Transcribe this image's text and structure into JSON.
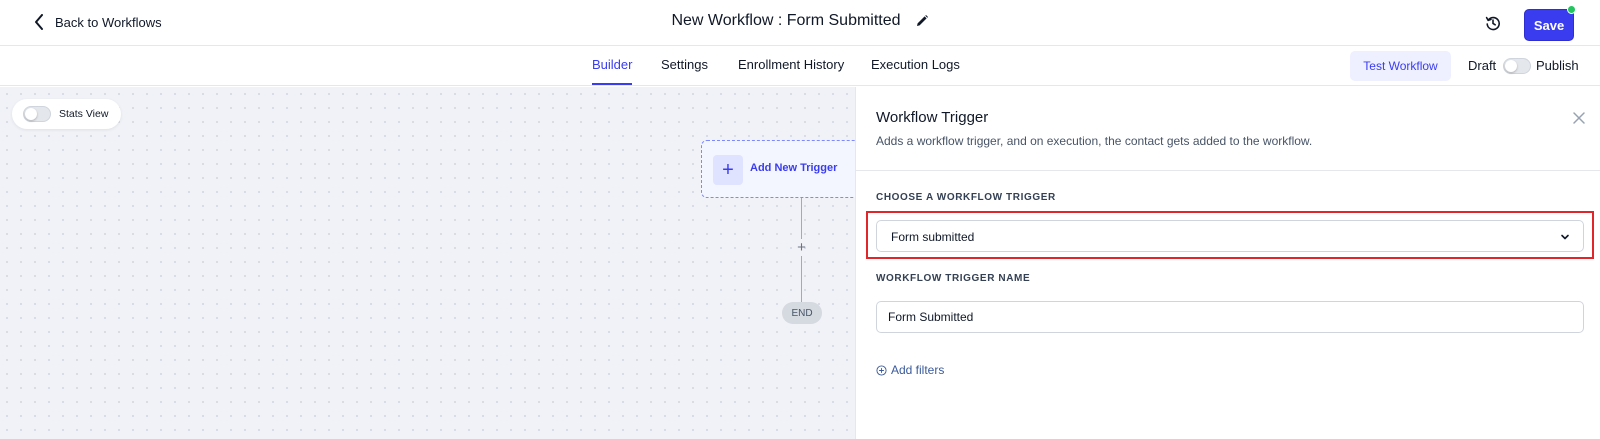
{
  "header": {
    "back_label": "Back to Workflows",
    "title": "New Workflow : Form Submitted",
    "save_label": "Save",
    "accent_color": "#3a3cf0",
    "status_dot_color": "#22c55e",
    "icons": [
      "chevron-left-icon",
      "pencil-icon",
      "history-icon"
    ]
  },
  "tabs": {
    "items": [
      {
        "label": "Builder",
        "active": true
      },
      {
        "label": "Settings",
        "active": false
      },
      {
        "label": "Enrollment History",
        "active": false
      },
      {
        "label": "Execution Logs",
        "active": false
      }
    ],
    "test_label": "Test Workflow",
    "draft_label": "Draft",
    "publish_label": "Publish",
    "publish_enabled": false
  },
  "canvas": {
    "stats_label": "Stats View",
    "stats_enabled": false,
    "trigger_label": "Add New Trigger",
    "end_label": "END"
  },
  "panel": {
    "title": "Workflow Trigger",
    "subtitle": "Adds a workflow trigger, and on execution, the contact gets added to the workflow.",
    "choose_label": "CHOOSE A WORKFLOW TRIGGER",
    "trigger_value": "Form submitted",
    "name_label": "WORKFLOW TRIGGER NAME",
    "name_value": "Form Submitted",
    "add_filters_label": "Add filters",
    "highlight_color": "#e0252b"
  }
}
